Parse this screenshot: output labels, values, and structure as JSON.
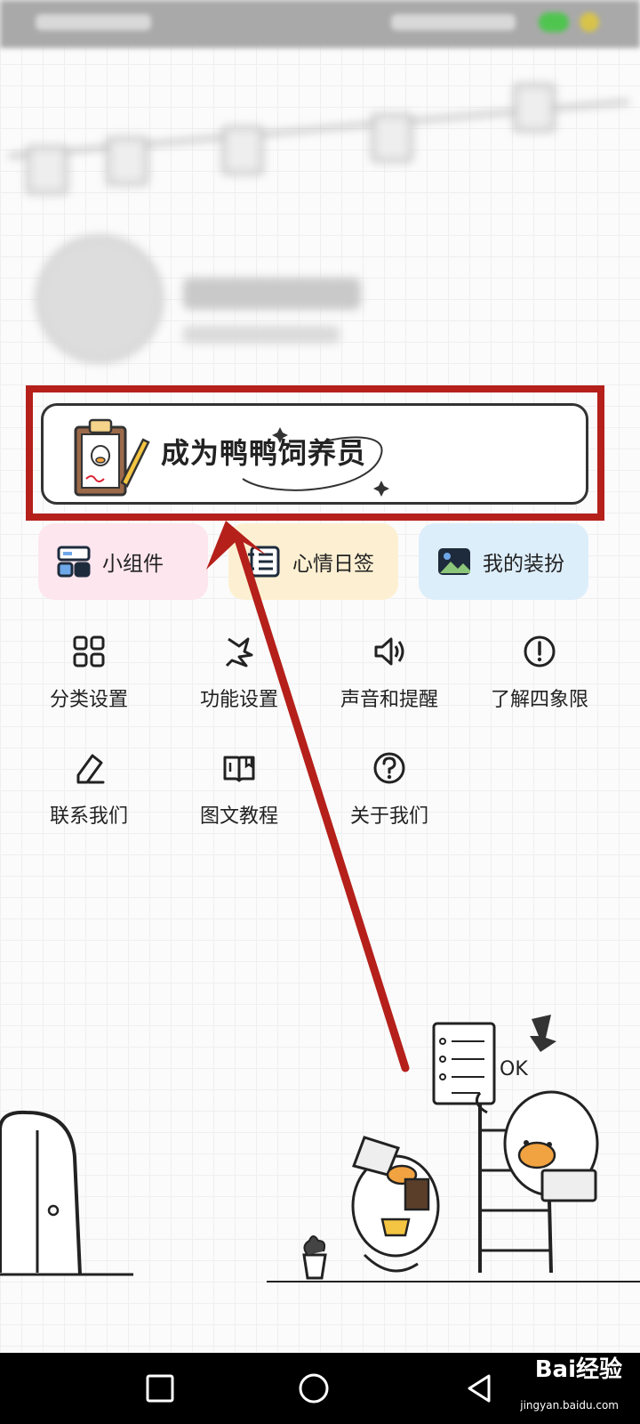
{
  "banner": {
    "title": "成为鸭鸭饲养员",
    "icon": "clipboard-duck-icon"
  },
  "quick_cards": [
    {
      "label": "小组件",
      "icon": "widget-icon",
      "bg": "#fde6ee"
    },
    {
      "label": "心情日签",
      "icon": "notebook-icon",
      "bg": "#fdf0d2"
    },
    {
      "label": "我的装扮",
      "icon": "picture-icon",
      "bg": "#ddeefb"
    }
  ],
  "menu": [
    {
      "label": "分类设置",
      "icon": "grid-icon"
    },
    {
      "label": "功能设置",
      "icon": "function-icon"
    },
    {
      "label": "声音和提醒",
      "icon": "speaker-icon"
    },
    {
      "label": "了解四象限",
      "icon": "exclamation-icon"
    },
    {
      "label": "联系我们",
      "icon": "edit-icon"
    },
    {
      "label": "图文教程",
      "icon": "book-icon"
    },
    {
      "label": "关于我们",
      "icon": "question-icon"
    }
  ],
  "illustration": {
    "ok_text": "OK"
  },
  "nav": {
    "back": "back-icon",
    "home": "home-icon",
    "recents": "recents-icon"
  },
  "watermark": {
    "text": "Bai经验",
    "sub": "jingyan.baidu.com"
  },
  "colors": {
    "highlight": "#b5201b",
    "arrow": "#b5201b"
  }
}
